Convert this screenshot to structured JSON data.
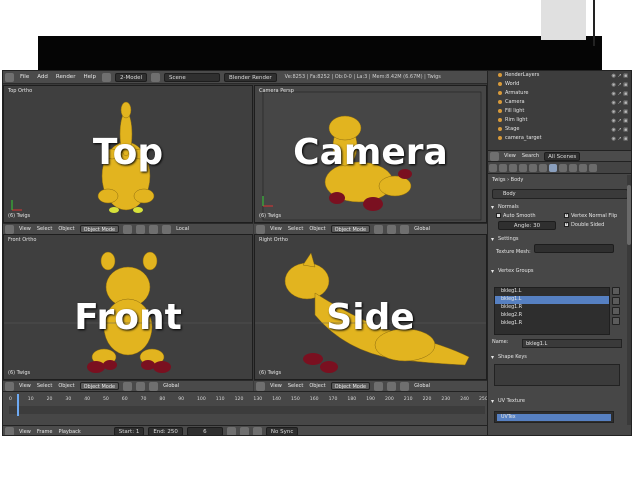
{
  "app": {
    "menu": [
      "File",
      "Add",
      "Render",
      "Help"
    ],
    "layout": "2-Model",
    "scene": "Scene",
    "engine": "Blender Render",
    "stats": "Ve:8253 | Fa:8252 | Ob:0-0 | La:3 | Mem:8.42M (6.67M) | Twigs"
  },
  "viewports": {
    "top": {
      "label": "Top Ortho",
      "corner": "(6) Twigs",
      "overlay": "Top"
    },
    "camera": {
      "label": "Camera Persp",
      "corner": "(6) Twigs",
      "overlay": "Camera"
    },
    "front": {
      "label": "Front Ortho",
      "corner": "(6) Twigs",
      "overlay": "Front"
    },
    "side": {
      "label": "Right Ortho",
      "corner": "(6) Twigs",
      "overlay": "Side"
    }
  },
  "viewport_header": {
    "view": "View",
    "select": "Select",
    "object": "Object",
    "mode": "Object Mode",
    "local": "Local",
    "global": "Global"
  },
  "timeline": {
    "ticks": [
      "0",
      "10",
      "20",
      "30",
      "40",
      "50",
      "60",
      "70",
      "80",
      "90",
      "100",
      "110",
      "120",
      "130",
      "140",
      "150",
      "160",
      "170",
      "180",
      "190",
      "200",
      "210",
      "220",
      "230",
      "240",
      "250"
    ],
    "menu": [
      "View",
      "Frame",
      "Playback"
    ],
    "start": "Start: 1",
    "end": "End: 250",
    "current": "6",
    "sync": "No Sync"
  },
  "outliner": {
    "items": [
      {
        "label": "RenderLayers",
        "sub": false
      },
      {
        "label": "World",
        "sub": false
      },
      {
        "label": "Armature",
        "sub": false
      },
      {
        "label": "Camera",
        "sub": false
      },
      {
        "label": "Fill light",
        "sub": false
      },
      {
        "label": "Rim light",
        "sub": false
      },
      {
        "label": "Stage",
        "sub": false
      },
      {
        "label": "camera_target",
        "sub": false
      }
    ],
    "view": "View",
    "search": "Search",
    "scenes": "All Scenes"
  },
  "properties": {
    "breadcrumb_obj": "Twigs",
    "breadcrumb_data": "Body",
    "mesh_name": "Body",
    "normals": {
      "title": "Normals",
      "auto_smooth": "Auto Smooth",
      "angle": "Angle: 30",
      "vertex_normal_flip": "Vertex Normal Flip",
      "double_sided": "Double Sided"
    },
    "settings": {
      "title": "Settings",
      "texture_mesh": "Texture Mesh:"
    },
    "vertex_groups": {
      "title": "Vertex Groups",
      "items": [
        "bkleg1.L",
        "bkleg1.L",
        "bkleg1.R",
        "bkleg2.R",
        "bkleg1.R"
      ],
      "selected_index": 1,
      "name_label": "Name:",
      "name_value": "bkleg1.L"
    },
    "shape_keys": {
      "title": "Shape Keys"
    },
    "uv_texture": {
      "title": "UV Texture",
      "item": "UVTex"
    }
  },
  "colors": {
    "giraffe_body": "#e2b41f",
    "giraffe_hoof": "#7a1020",
    "viewport_bg": "#3f3f3f",
    "selection": "#5680c2"
  }
}
